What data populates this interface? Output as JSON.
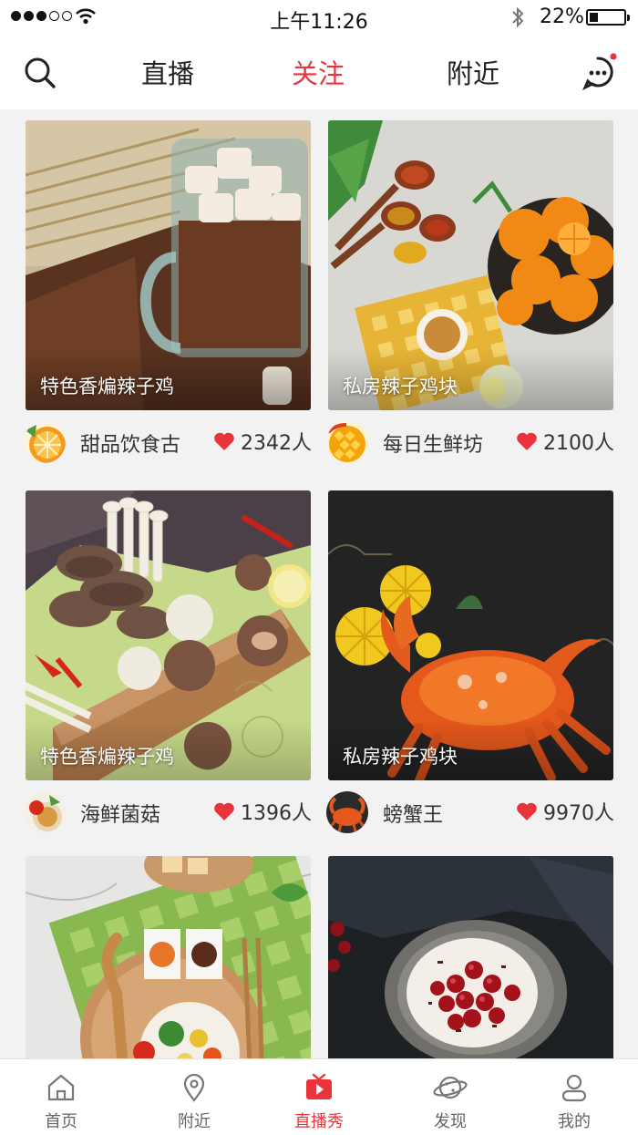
{
  "status_bar": {
    "time": "上午11:26",
    "battery": "22%",
    "signal_dots_filled": 3,
    "signal_dots_total": 5,
    "battery_level": 0.22
  },
  "header": {
    "tabs": [
      {
        "label": "直播",
        "active": false
      },
      {
        "label": "关注",
        "active": true
      },
      {
        "label": "附近",
        "active": false
      }
    ],
    "has_unread_message": true,
    "accent_color": "#e8343a"
  },
  "feed": [
    {
      "caption": "特色香煸辣子鸡",
      "author": "甜品饮食古",
      "likes": "2342人",
      "image": "cocoa-marshmallow-mug",
      "avatar": "orange-slice"
    },
    {
      "caption": "私房辣子鸡块",
      "author": "每日生鲜坊",
      "likes": "2100人",
      "image": "oranges-and-spices",
      "avatar": "mango"
    },
    {
      "caption": "特色香煸辣子鸡",
      "author": "海鲜菌菇",
      "likes": "1396人",
      "image": "mushrooms-on-board",
      "avatar": "tomato-dish"
    },
    {
      "caption": "私房辣子鸡块",
      "author": "螃蟹王",
      "likes": "9970人",
      "image": "crab-with-chrysanthemum",
      "avatar": "crab"
    },
    {
      "caption": "",
      "author": "",
      "likes": "",
      "image": "rice-bowl-on-gingham",
      "avatar": ""
    },
    {
      "caption": "",
      "author": "",
      "likes": "",
      "image": "cherry-cake",
      "avatar": ""
    }
  ],
  "tabbar": [
    {
      "label": "首页",
      "icon": "home-icon",
      "active": false
    },
    {
      "label": "附近",
      "icon": "location-icon",
      "active": false
    },
    {
      "label": "直播秀",
      "icon": "tv-icon",
      "active": true
    },
    {
      "label": "发现",
      "icon": "planet-icon",
      "active": false
    },
    {
      "label": "我的",
      "icon": "user-icon",
      "active": false
    }
  ]
}
